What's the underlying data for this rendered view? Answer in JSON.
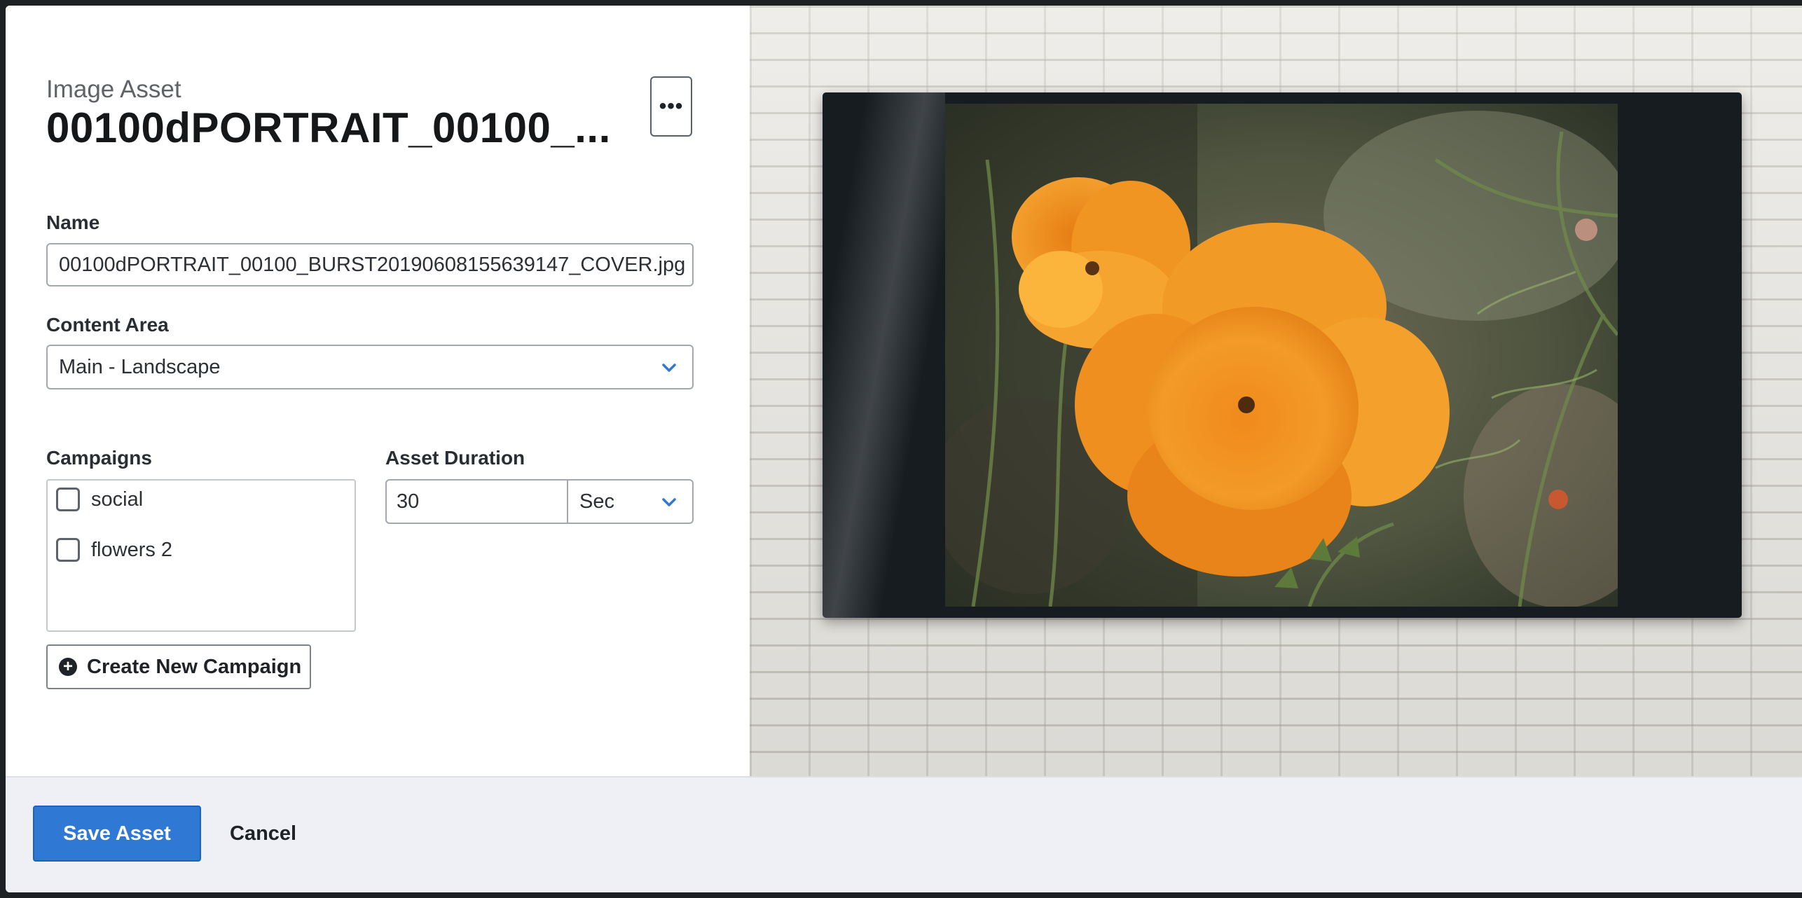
{
  "header": {
    "subtitle": "Image Asset",
    "title": "00100dPORTRAIT_00100_...",
    "more_label": "•••"
  },
  "form": {
    "name_label": "Name",
    "name_value": "00100dPORTRAIT_00100_BURST20190608155639147_COVER.jpg",
    "content_area_label": "Content Area",
    "content_area_value": "Main - Landscape",
    "campaigns_label": "Campaigns",
    "campaigns": [
      {
        "label": "social",
        "checked": false
      },
      {
        "label": "flowers 2",
        "checked": false
      }
    ],
    "create_campaign_label": "Create New Campaign",
    "duration_label": "Asset Duration",
    "duration_value": "30",
    "duration_unit": "Sec"
  },
  "footer": {
    "save_label": "Save Asset",
    "cancel_label": "Cancel"
  },
  "preview": {
    "photo_subject": "orange-poppy-flowers"
  },
  "colors": {
    "primary": "#2f78d3",
    "chevron": "#2f78d3",
    "footer_bg": "#eef0f5",
    "screen_frame": "#171c20"
  },
  "icons": [
    "more-horizontal-icon",
    "chevron-down-icon",
    "plus-circle-icon"
  ]
}
